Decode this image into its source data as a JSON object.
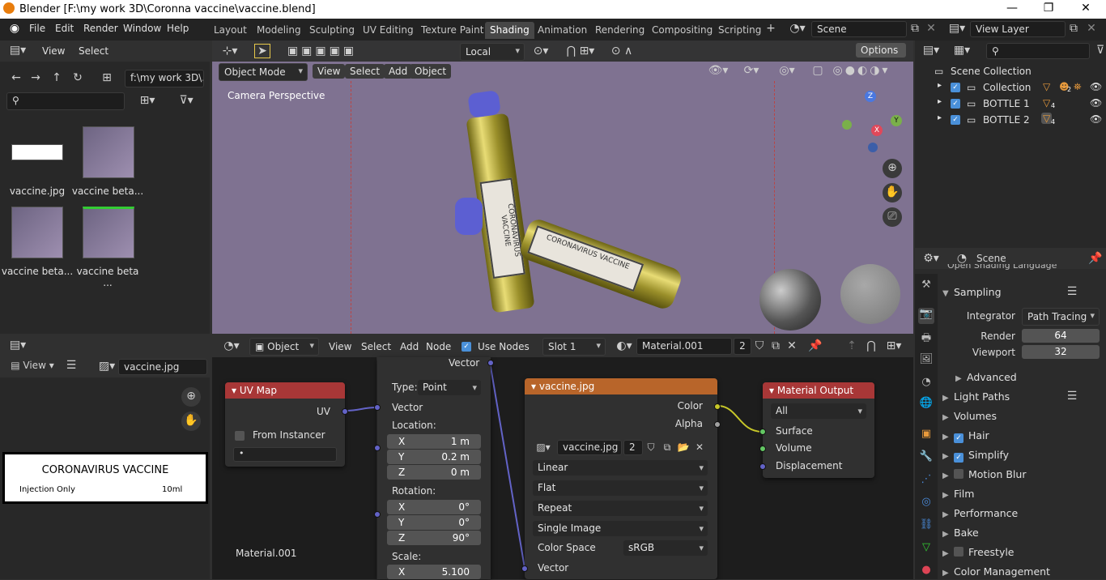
{
  "window": {
    "title": "Blender [F:\\my work 3D\\Coronna vaccine\\vaccine.blend]",
    "minimize": "—",
    "maximize": "❐",
    "close": "✕"
  },
  "menu": [
    "File",
    "Edit",
    "Render",
    "Window",
    "Help"
  ],
  "workspaces": [
    "Layout",
    "Modeling",
    "Sculpting",
    "UV Editing",
    "Texture Paint",
    "Shading",
    "Animation",
    "Rendering",
    "Compositing",
    "Scripting"
  ],
  "active_workspace": "Shading",
  "scene": {
    "name": "Scene",
    "view_layer": "View Layer"
  },
  "file_browser": {
    "menu_view": "View",
    "menu_select": "Select",
    "path": "f:\\my work 3D\\...",
    "files": [
      {
        "name": "vaccine.jpg"
      },
      {
        "name": "vaccine beta..."
      },
      {
        "name": "vaccine beta..."
      },
      {
        "name": "vaccine beta ..."
      }
    ]
  },
  "viewport": {
    "mode": "Object Mode",
    "menus": [
      "View",
      "Select",
      "Add",
      "Object"
    ],
    "transform": "Local",
    "options": "Options",
    "perspective_label": "Camera Perspective",
    "bottle_label": "CORONAVIRUS VACCINE",
    "bottle_sub": "Injection Only",
    "bottle_dose": "10ml"
  },
  "outliner": {
    "root": "Scene Collection",
    "items": [
      {
        "name": "Collection",
        "badge": "2"
      },
      {
        "name": "BOTTLE 1",
        "badge": "4"
      },
      {
        "name": "BOTTLE 2",
        "badge": "4"
      }
    ]
  },
  "properties": {
    "context": "Scene",
    "clipped_text": "Open Shading Language",
    "sampling": "Sampling",
    "integrator_label": "Integrator",
    "integrator": "Path Tracing",
    "render_label": "Render",
    "render": "64",
    "viewport_label": "Viewport",
    "viewport": "32",
    "advanced": "Advanced",
    "sections": [
      {
        "name": "Light Paths",
        "check": null
      },
      {
        "name": "Volumes",
        "check": null
      },
      {
        "name": "Hair",
        "check": true
      },
      {
        "name": "Simplify",
        "check": true
      },
      {
        "name": "Motion Blur",
        "check": false
      },
      {
        "name": "Film",
        "check": null
      },
      {
        "name": "Performance",
        "check": null
      },
      {
        "name": "Bake",
        "check": null
      },
      {
        "name": "Freestyle",
        "check": false
      },
      {
        "name": "Color Management",
        "check": null
      }
    ]
  },
  "image_editor": {
    "view": "View",
    "image": "vaccine.jpg",
    "label_title": "CORONAVIRUS VACCINE",
    "label_sub": "Injection Only",
    "label_dose": "10ml"
  },
  "node_editor": {
    "object": "Object",
    "menus": [
      "View",
      "Select",
      "Add",
      "Node"
    ],
    "use_nodes": "Use Nodes",
    "slot": "Slot 1",
    "material": "Material.001",
    "users": "2",
    "material_footer": "Material.001",
    "uvmap": {
      "title": "UV Map",
      "out": "UV",
      "from_instancer": "From Instancer",
      "field": "•"
    },
    "mapping": {
      "vector_top": "Vector",
      "type_label": "Type:",
      "type": "Point",
      "vector": "Vector",
      "location": "Location:",
      "loc": [
        {
          "a": "X",
          "v": "1 m"
        },
        {
          "a": "Y",
          "v": "0.2 m"
        },
        {
          "a": "Z",
          "v": "0 m"
        }
      ],
      "rotation": "Rotation:",
      "rot": [
        {
          "a": "X",
          "v": "0°"
        },
        {
          "a": "Y",
          "v": "0°"
        },
        {
          "a": "Z",
          "v": "90°"
        }
      ],
      "scale": "Scale:",
      "scl": [
        {
          "a": "X",
          "v": "5.100"
        }
      ]
    },
    "image_texture": {
      "title": "vaccine.jpg",
      "color": "Color",
      "alpha": "Alpha",
      "image": "vaccine.jpg",
      "users": "2",
      "interpolation": "Linear",
      "projection": "Flat",
      "extension": "Repeat",
      "source": "Single Image",
      "color_space_label": "Color Space",
      "color_space": "sRGB",
      "vector": "Vector"
    },
    "output": {
      "title": "Material Output",
      "target": "All",
      "surface": "Surface",
      "volume": "Volume",
      "displacement": "Displacement"
    }
  },
  "colors": {
    "accent": "#4772b3",
    "node_output_red": "#c23b3b",
    "node_texture_orange": "#c7702e",
    "socket_yellow": "#c7c729",
    "socket_grey": "#a1a1a1",
    "socket_green": "#63c763",
    "socket_purple": "#6363c7"
  }
}
